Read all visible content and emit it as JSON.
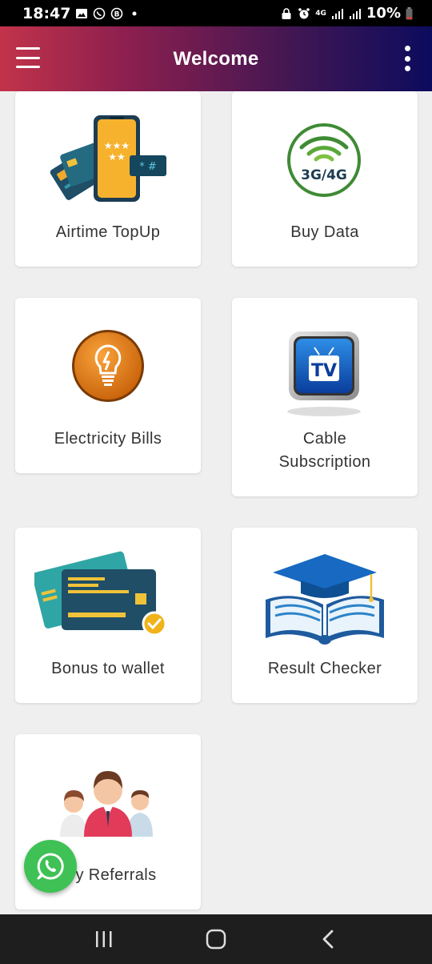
{
  "status_bar": {
    "time": "18:47",
    "battery": "10%",
    "network": "4G",
    "icons": [
      "gallery-icon",
      "whatsapp-icon",
      "b-icon",
      "dot-icon",
      "lock-icon",
      "alarm-icon",
      "signal-icon",
      "battery-icon"
    ]
  },
  "app_bar": {
    "title": "Welcome",
    "gradient": [
      "#c2334a",
      "#3d1653",
      "#0c0b5e"
    ]
  },
  "services": [
    {
      "label": "Airtime TopUp",
      "icon": "phone-card-icon"
    },
    {
      "label": "Buy Data",
      "icon": "wifi-3g4g-icon"
    },
    {
      "label": "Electricity Bills",
      "icon": "bulb-icon"
    },
    {
      "label": "Cable Subscription",
      "label_line1": "Cable",
      "label_line2": "Subscription",
      "icon": "tv-icon"
    },
    {
      "label": "Bonus to wallet",
      "icon": "credit-card-icon"
    },
    {
      "label": "Result Checker",
      "icon": "graduation-cap-icon"
    },
    {
      "label": "y Referrals",
      "icon": "people-icon"
    }
  ],
  "badge_3g4g": "3G/4G",
  "tv_text": "TV",
  "colors": {
    "whatsapp": "#3fc155",
    "background": "#efefef"
  }
}
